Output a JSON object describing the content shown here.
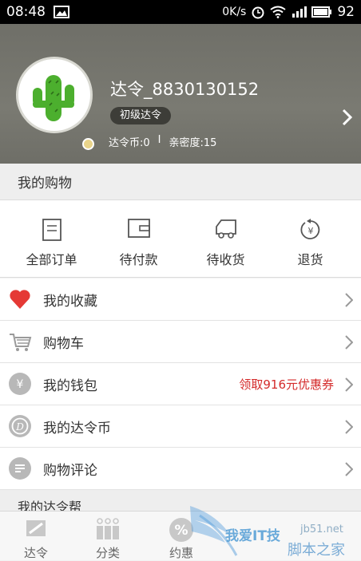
{
  "status_bar": {
    "time": "08:48",
    "speed": "0K/s",
    "battery": "92"
  },
  "profile": {
    "username": "达令_8830130152",
    "level": "初级达令",
    "coins": "达令币:0",
    "separator": "I",
    "intimacy": "亲密度:15"
  },
  "shopping": {
    "title": "我的购物",
    "orders": [
      {
        "label": "全部订单",
        "icon": "order-list-icon"
      },
      {
        "label": "待付款",
        "icon": "wallet-icon"
      },
      {
        "label": "待收货",
        "icon": "truck-icon"
      },
      {
        "label": "退货",
        "icon": "return-icon"
      }
    ]
  },
  "menu": [
    {
      "label": "我的收藏",
      "icon": "heart-icon",
      "extra": ""
    },
    {
      "label": "购物车",
      "icon": "cart-icon",
      "extra": ""
    },
    {
      "label": "我的钱包",
      "icon": "yuan-icon",
      "extra": "领取916元优惠券"
    },
    {
      "label": "我的达令币",
      "icon": "coin-icon",
      "extra": ""
    },
    {
      "label": "购物评论",
      "icon": "comment-icon",
      "extra": ""
    }
  ],
  "section2": {
    "title": "我的达令帮"
  },
  "tabs": [
    {
      "label": "达令",
      "icon": "dalin-icon"
    },
    {
      "label": "分类",
      "icon": "category-icon"
    },
    {
      "label": "约惠",
      "icon": "percent-icon"
    }
  ],
  "watermark": {
    "text": "我爱IT技",
    "url": "jb51.net",
    "cn": "脚本之家"
  },
  "colors": {
    "accent_red": "#d42a2a",
    "header_bg": "#76766e",
    "heart": "#e53935"
  }
}
